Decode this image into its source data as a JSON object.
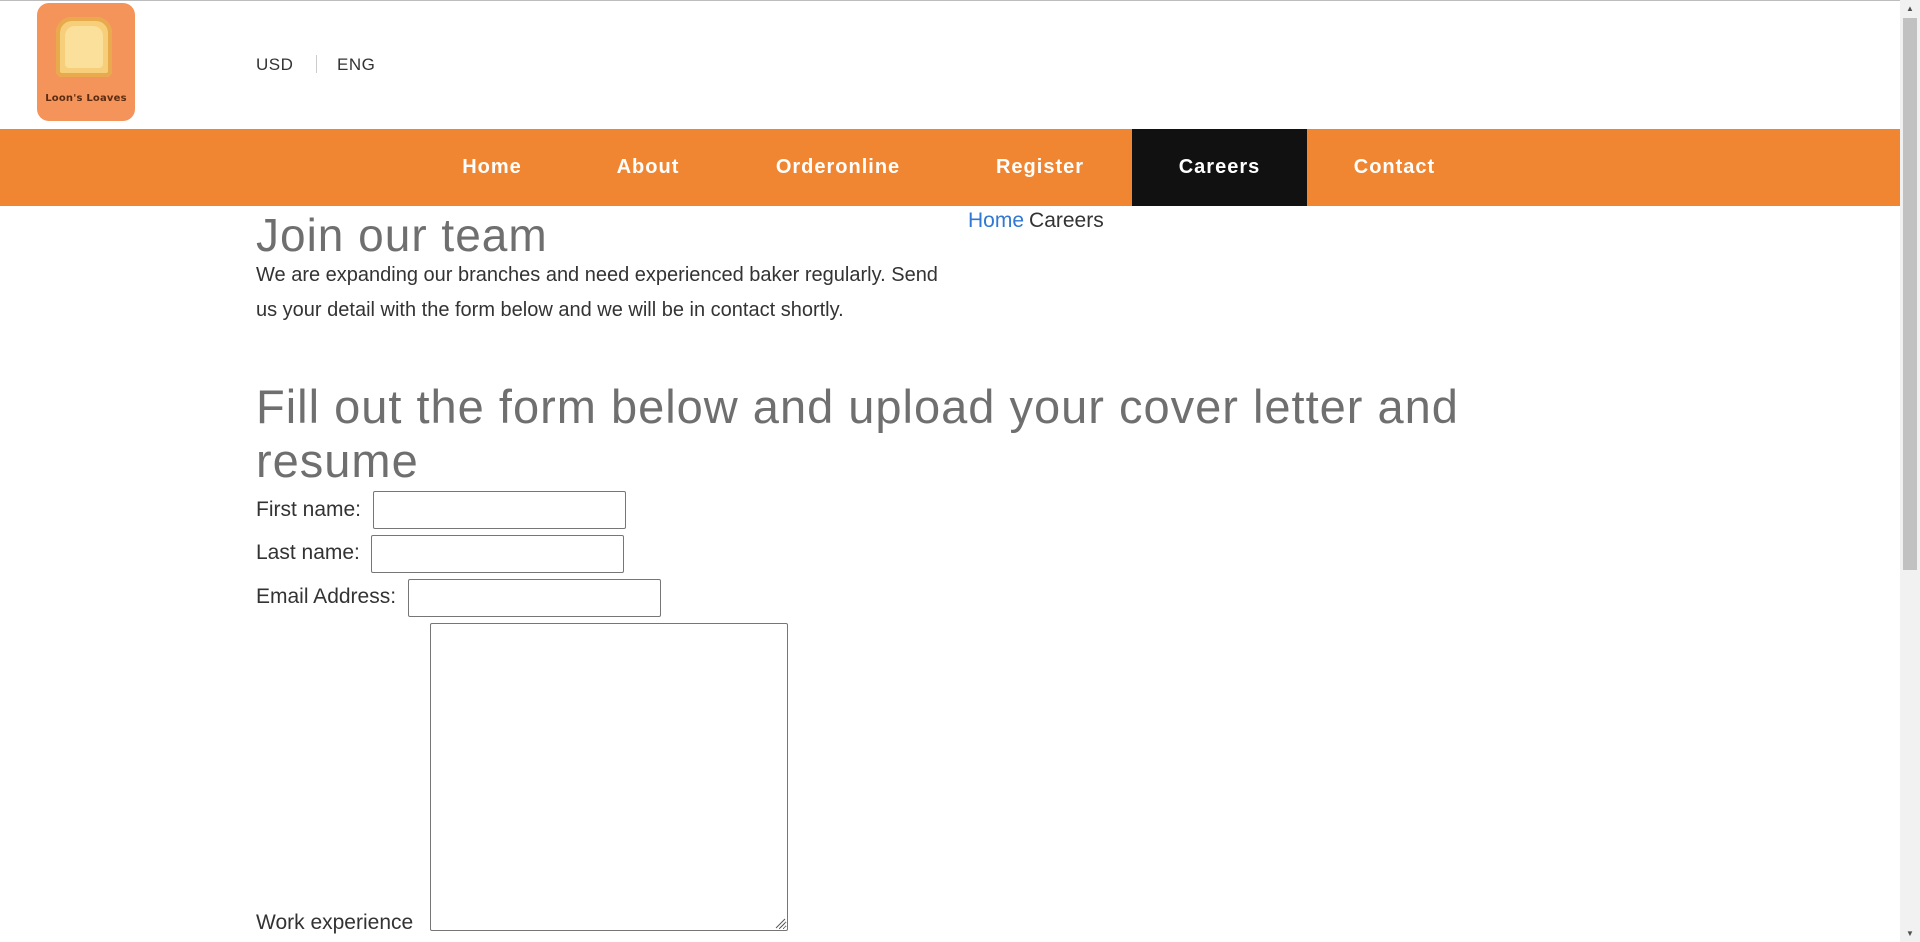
{
  "header": {
    "logo_text": "Loon's Loaves",
    "currency": "USD",
    "language": "ENG"
  },
  "nav": {
    "items": [
      {
        "label": "Home"
      },
      {
        "label": "About"
      },
      {
        "label": "Orderonline"
      },
      {
        "label": "Register"
      },
      {
        "label": "Careers",
        "active": true
      },
      {
        "label": "Contact"
      }
    ]
  },
  "main": {
    "title": "Join our team",
    "intro": "We are expanding our branches and need experienced baker regularly. Send us your detail with the form below and we will be in contact shortly.",
    "breadcrumb": {
      "home": "Home",
      "current": "Careers"
    },
    "form_title": "Fill out the form below and upload your cover letter and resume",
    "form": {
      "first_name_label": "First name:",
      "first_name_value": "",
      "last_name_label": "Last name:",
      "last_name_value": "",
      "email_label": "Email Address:",
      "email_value": "",
      "experience_label": "Work experience",
      "experience_value": ""
    }
  },
  "colors": {
    "nav_background": "#f08632",
    "nav_active": "#111111",
    "link": "#2f78d3",
    "heading": "#6f6f6f",
    "logo_background": "#f4935a"
  },
  "icons": {
    "scroll_up": "triangle-up-icon",
    "scroll_down": "triangle-down-icon",
    "resize": "resize-grip-icon"
  }
}
